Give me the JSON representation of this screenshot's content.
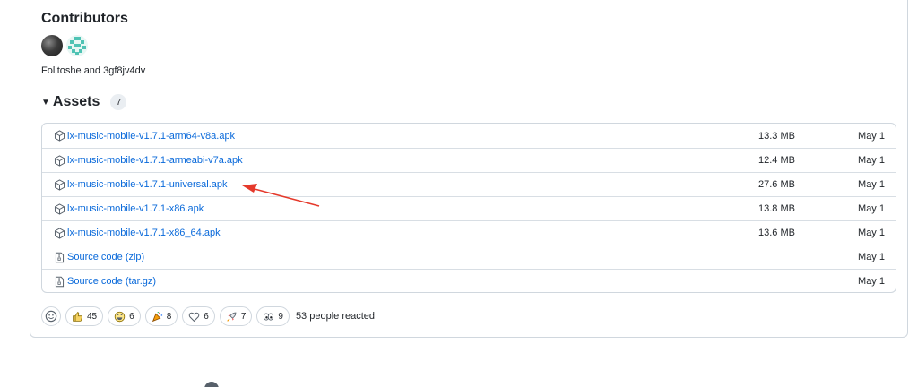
{
  "contributors": {
    "title": "Contributors",
    "names": "Folltoshe and 3gf8jv4dv"
  },
  "assets": {
    "title": "Assets",
    "count": "7",
    "items": [
      {
        "name": "lx-music-mobile-v1.7.1-arm64-v8a.apk",
        "size": "13.3 MB",
        "date": "May 1",
        "icon": "package-icon"
      },
      {
        "name": "lx-music-mobile-v1.7.1-armeabi-v7a.apk",
        "size": "12.4 MB",
        "date": "May 1",
        "icon": "package-icon"
      },
      {
        "name": "lx-music-mobile-v1.7.1-universal.apk",
        "size": "27.6 MB",
        "date": "May 1",
        "icon": "package-icon"
      },
      {
        "name": "lx-music-mobile-v1.7.1-x86.apk",
        "size": "13.8 MB",
        "date": "May 1",
        "icon": "package-icon"
      },
      {
        "name": "lx-music-mobile-v1.7.1-x86_64.apk",
        "size": "13.6 MB",
        "date": "May 1",
        "icon": "package-icon"
      },
      {
        "name": "Source code (zip)",
        "size": "",
        "date": "May 1",
        "icon": "file-zip-icon"
      },
      {
        "name": "Source code (tar.gz)",
        "size": "",
        "date": "May 1",
        "icon": "file-zip-icon"
      }
    ]
  },
  "reactions": {
    "items": [
      {
        "emoji": "thumbs-up",
        "count": "45"
      },
      {
        "emoji": "laugh",
        "count": "6"
      },
      {
        "emoji": "hooray",
        "count": "8"
      },
      {
        "emoji": "heart",
        "count": "6"
      },
      {
        "emoji": "rocket",
        "count": "7"
      },
      {
        "emoji": "eyes",
        "count": "9"
      }
    ],
    "summary": "53 people reacted"
  },
  "colors": {
    "link": "#0969da",
    "border": "#d0d7de",
    "annotation_arrow": "#e5392b"
  }
}
